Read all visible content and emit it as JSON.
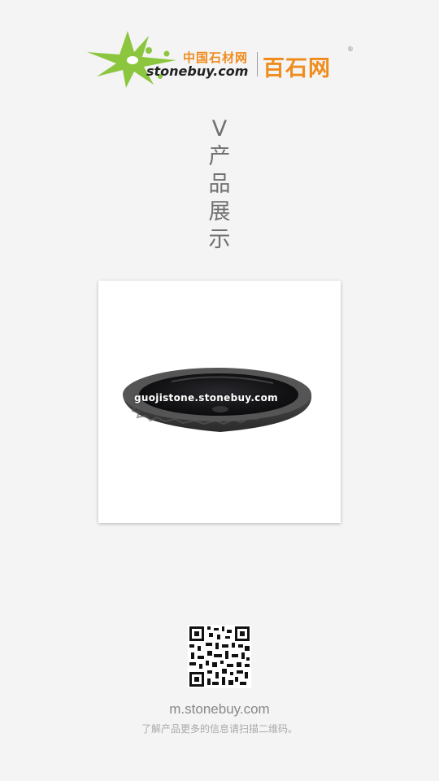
{
  "logo": {
    "cn_small": "中国石材网",
    "en": "stonebuy.com",
    "cn_big": "百石网",
    "reg": "®"
  },
  "section": {
    "chars": [
      "V",
      "产",
      "品",
      "展",
      "示"
    ]
  },
  "product": {
    "watermark": "guojistone.stonebuy.com"
  },
  "footer": {
    "site": "m.stonebuy.com",
    "hint": "了解产品更多的信息请扫描二维码。"
  },
  "colors": {
    "brand_orange": "#f08c1e",
    "brand_green": "#8cc63f",
    "background": "#f4f4f4"
  }
}
